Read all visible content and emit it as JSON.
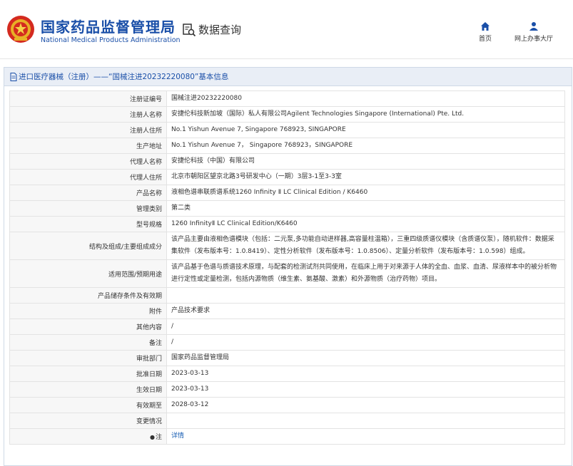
{
  "header": {
    "brand_cn": "国家药品监督管理局",
    "brand_en": "National Medical Products Administration",
    "query_label": "数据查询",
    "nav": [
      {
        "label": "首页",
        "icon": "home-icon"
      },
      {
        "label": "网上办事大厅",
        "icon": "person-icon"
      }
    ]
  },
  "panel": {
    "title": "进口医疗器械（注册）——“国械注进20232220080”基本信息"
  },
  "rows": [
    {
      "label": "注册证编号",
      "value": "国械注进20232220080"
    },
    {
      "label": "注册人名称",
      "value": "安捷伦科技新加坡（国际）私人有限公司Agilent Technologies Singapore (International) Pte. Ltd."
    },
    {
      "label": "注册人住所",
      "value": "No.1 Yishun Avenue 7, Singapore 768923, SINGAPORE"
    },
    {
      "label": "生产地址",
      "value": "No.1 Yishun Avenue 7， Singapore 768923，SINGAPORE"
    },
    {
      "label": "代理人名称",
      "value": "安捷伦科技（中国）有限公司"
    },
    {
      "label": "代理人住所",
      "value": "北京市朝阳区望京北路3号研发中心（一期）3层3-1至3-3室"
    },
    {
      "label": "产品名称",
      "value": "液相色谱串联质谱系统1260 Infinity Ⅱ LC Clinical Edition / K6460"
    },
    {
      "label": "管理类别",
      "value": "第二类"
    },
    {
      "label": "型号规格",
      "value": "1260 InfinityⅡ LC Clinical Edition/K6460"
    },
    {
      "label": "结构及组成/主要组成成分",
      "value": "该产品主要由液相色谱模块（包括：二元泵,多功能自动进样器,高容量柱温箱），三重四级质谱仪模块（含质谱仪泵），随机软件：数据采集软件（发布版本号：1.0.8419）、定性分析软件（发布版本号：1.0.8506）、定量分析软件（发布版本号：1.0.598）组成。",
      "tall": true
    },
    {
      "label": "适用范围/预期用途",
      "value": "该产品基于色谱与质谱技术原理，与配套的检测试剂共同使用，在临床上用于对来源于人体的全血、血浆、血清、尿液样本中的被分析物进行定性或定量检测，包括内源物质（维生素、氨基酸、激素）和外源物质（治疗药物）项目。",
      "tall": true
    },
    {
      "label": "产品储存条件及有效期",
      "value": ""
    },
    {
      "label": "附件",
      "value": "产品技术要求"
    },
    {
      "label": "其他内容",
      "value": "/"
    },
    {
      "label": "备注",
      "value": "/"
    },
    {
      "label": "审批部门",
      "value": "国家药品监督管理局"
    },
    {
      "label": "批准日期",
      "value": "2023-03-13"
    },
    {
      "label": "生效日期",
      "value": "2023-03-13"
    },
    {
      "label": "有效期至",
      "value": "2028-03-12"
    },
    {
      "label": "变更情况",
      "value": ""
    }
  ],
  "note_row": {
    "label": "注",
    "icon": "note-icon",
    "link": "详情"
  }
}
